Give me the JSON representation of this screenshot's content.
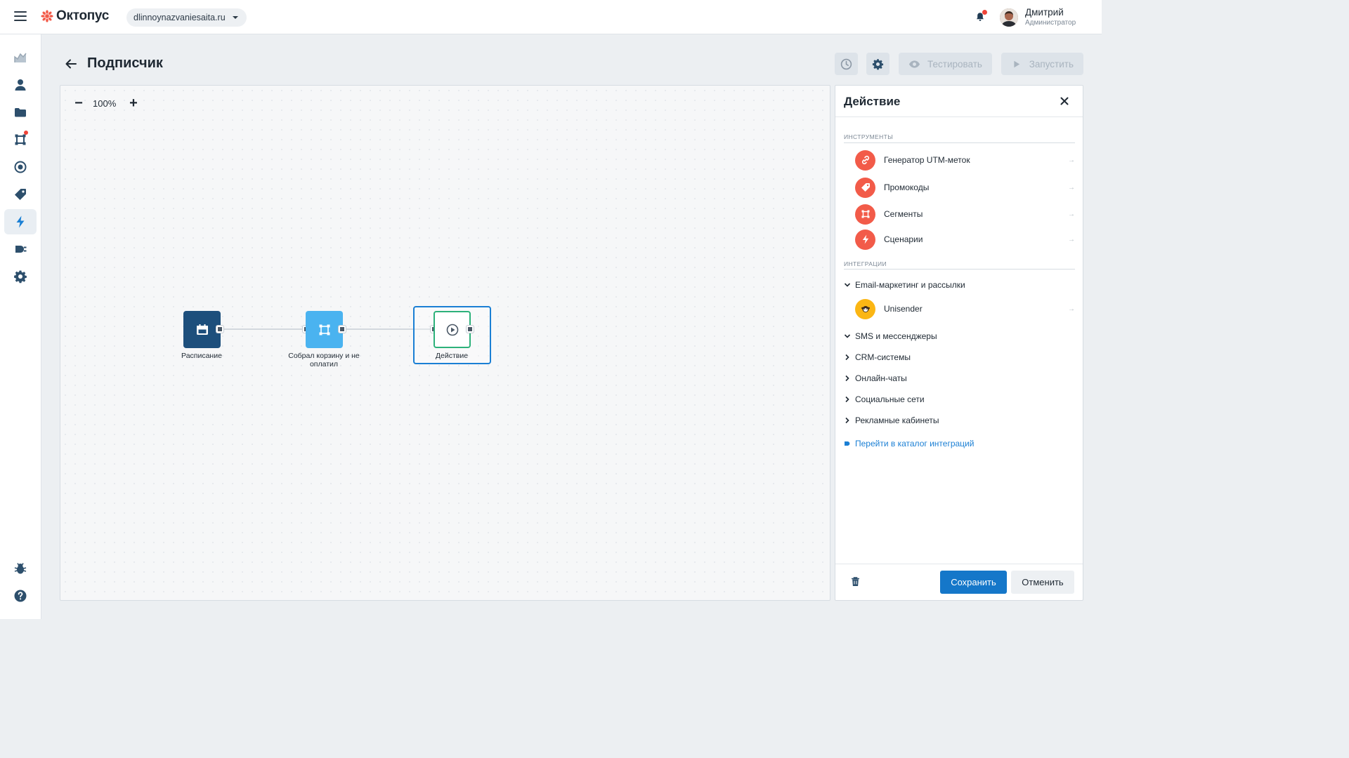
{
  "app": {
    "logo_text": "Октопус",
    "site": "dlinnoynazvaniesaita.ru"
  },
  "user": {
    "name": "Дмитрий",
    "role": "Администратор"
  },
  "colors": {
    "accent": "#1577c9",
    "brand": "#f25b49",
    "rail_icon": "#2d4f6c",
    "node_dark": "#1d4f7c",
    "node_light": "#4ab3f0",
    "node_action": "#2db17a"
  },
  "rail": {
    "items": [
      {
        "icon": "chart-icon"
      },
      {
        "icon": "user-icon"
      },
      {
        "icon": "folder-icon"
      },
      {
        "icon": "segment-icon"
      },
      {
        "icon": "target-icon"
      },
      {
        "icon": "tag-icon"
      },
      {
        "icon": "lightning-icon",
        "active": true
      },
      {
        "icon": "plug-icon"
      },
      {
        "icon": "gear-icon"
      },
      {
        "icon": "bug-icon"
      },
      {
        "icon": "help-icon"
      }
    ]
  },
  "header": {
    "title": "Подписчик",
    "test_label": "Тестировать",
    "run_label": "Запустить"
  },
  "canvas": {
    "zoom": "100%",
    "nodes": [
      {
        "label": "Расписание",
        "icon": "calendar-icon"
      },
      {
        "label": "Собрал корзину и не оплатил",
        "icon": "segment-icon"
      },
      {
        "label": "Действие",
        "icon": "play-icon",
        "selected": true
      }
    ]
  },
  "panel": {
    "title": "Действие",
    "tools_label": "ИНСТРУМЕНТЫ",
    "tools": [
      {
        "label": "Генератор UTM-меток",
        "icon": "link-icon"
      },
      {
        "label": "Промокоды",
        "icon": "tag-icon"
      },
      {
        "label": "Сегменты",
        "icon": "segment-icon"
      },
      {
        "label": "Сценарии",
        "icon": "lightning-icon"
      }
    ],
    "integrations_label": "ИНТЕГРАЦИИ",
    "groups": [
      {
        "label": "Email-маркетинг и рассылки",
        "expanded": true
      },
      {
        "label": "SMS и мессенджеры",
        "expanded": true
      },
      {
        "label": "CRM-системы",
        "expanded": false
      },
      {
        "label": "Онлайн-чаты",
        "expanded": false
      },
      {
        "label": "Социальные сети",
        "expanded": false
      },
      {
        "label": "Рекламные кабинеты",
        "expanded": false
      }
    ],
    "integration_item": {
      "label": "Unisender",
      "icon": "monkey-icon"
    },
    "catalog_link": "Перейти в каталог интеграций",
    "save_label": "Сохранить",
    "cancel_label": "Отменить"
  }
}
